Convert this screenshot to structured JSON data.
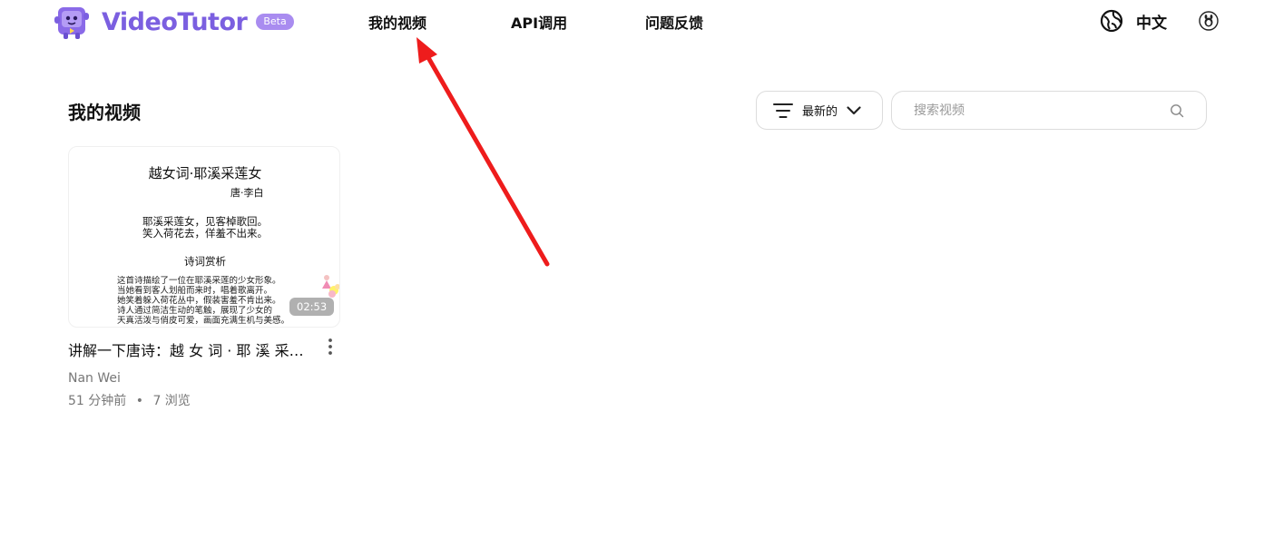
{
  "app": {
    "brand": "VideoTutor",
    "badge": "Beta"
  },
  "nav": {
    "items": [
      {
        "label": "我的视频"
      },
      {
        "label": "API调用"
      },
      {
        "label": "问题反馈"
      }
    ],
    "language": "中文"
  },
  "main": {
    "title": "我的视频",
    "sort": {
      "label": "最新的"
    },
    "search": {
      "placeholder": "搜索视频",
      "value": ""
    }
  },
  "videos": [
    {
      "thumbnail": {
        "title": "越女词·耶溪采莲女",
        "author": "唐·李白",
        "line1": "耶溪采莲女，见客棹歌回。",
        "line2": "笑入荷花去，佯羞不出来。",
        "subtitle": "诗词赏析",
        "body": [
          "这首诗描绘了一位在耶溪采莲的少女形象。",
          "当她看到客人划船而来时，唱着歌离开。",
          "她笑着躲入荷花丛中，假装害羞不肯出来。",
          "诗人通过简洁生动的笔触，展现了少女的",
          "天真活泼与俏皮可爱，画面充满生机与美感。"
        ]
      },
      "duration": "02:53",
      "title": "讲解一下唐诗：越 女 词 · 耶 溪 采 莲 女",
      "author": "Nan Wei",
      "time": "51 分钟前",
      "separator": "•",
      "views": "7 浏览"
    }
  ],
  "colors": {
    "brand": "#7b5fe0",
    "badge": "#a98cf0",
    "annotation_arrow": "#ee1c1c"
  },
  "icons": [
    "logo-mascot-icon",
    "globe-icon",
    "user-avatar-icon",
    "filter-icon",
    "chevron-down-icon",
    "search-icon",
    "more-vertical-icon"
  ]
}
